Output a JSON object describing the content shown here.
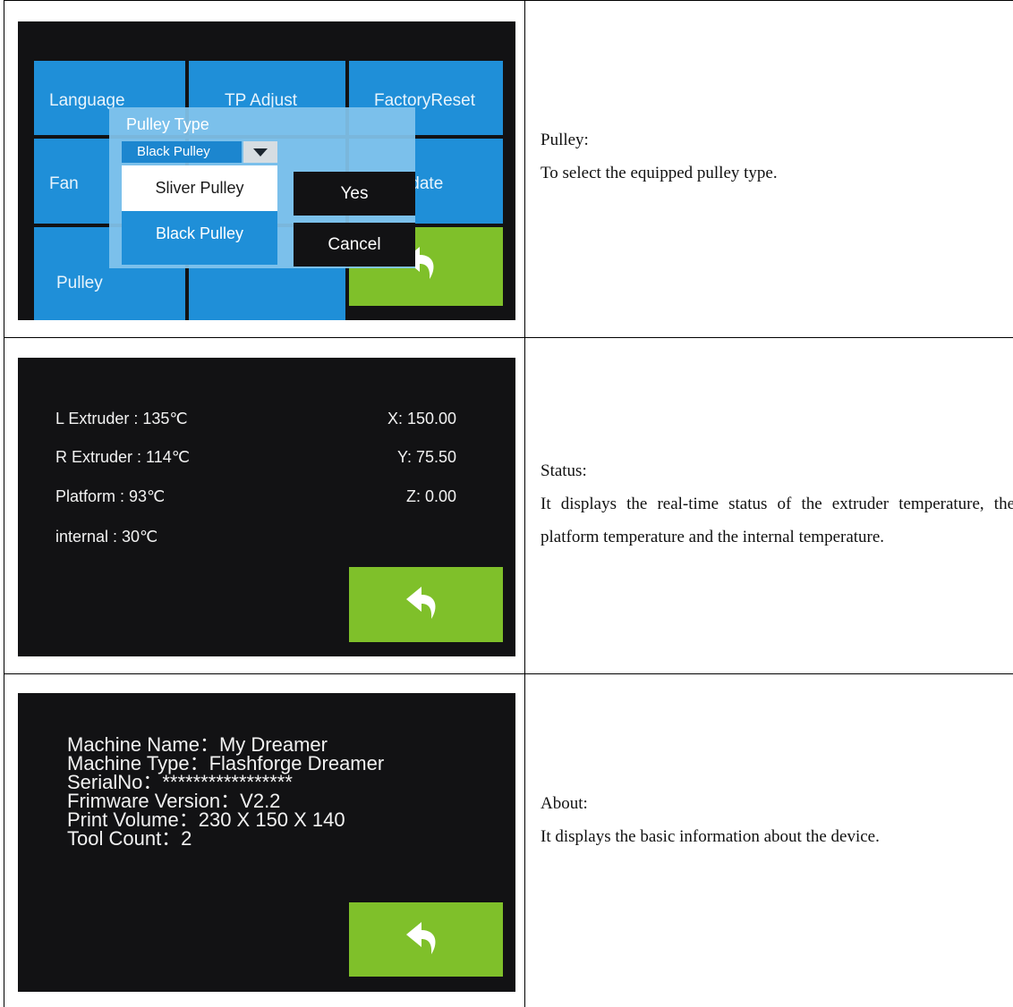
{
  "pulley_row": {
    "screen": {
      "tiles": {
        "language": "Language",
        "tp_adjust": "TP Adjust",
        "factory_reset": "FactoryReset",
        "fan": "Fan",
        "update": "Update",
        "pulley": "Pulley"
      },
      "dialog": {
        "title": "Pulley Type",
        "selected": "Black Pulley",
        "options": [
          "Sliver Pulley",
          "Black Pulley"
        ],
        "yes": "Yes",
        "cancel": "Cancel"
      }
    },
    "heading": "Pulley:",
    "text": "To select the equipped pulley type."
  },
  "status_row": {
    "screen": {
      "l_extruder": "L Extruder : 135℃",
      "r_extruder": "R Extruder : 114℃",
      "platform": "Platform : 93℃",
      "internal": "internal : 30℃",
      "x": "X: 150.00",
      "y": "Y: 75.50",
      "z": "Z: 0.00"
    },
    "heading": "Status:",
    "text": "It displays the real-time status of the extruder temperature, the platform temperature and the internal temperature."
  },
  "about_row": {
    "screen": {
      "machine_name": "Machine Name：My Dreamer",
      "machine_type": "Machine Type：Flashforge Dreamer",
      "serial": "SerialNo：*****************",
      "firmware": "Frimware Version：V2.2",
      "volume": "Print Volume：230 X 150 X 140",
      "tool_count": "Tool Count：2"
    },
    "heading": "About:",
    "text": "It displays the basic information about the device."
  },
  "colors": {
    "tile_blue": "#1f8fd8",
    "back_green": "#7fc02a",
    "screen_bg": "#121214"
  },
  "icons": [
    "back-arrow-icon",
    "dropdown-arrow-icon"
  ]
}
